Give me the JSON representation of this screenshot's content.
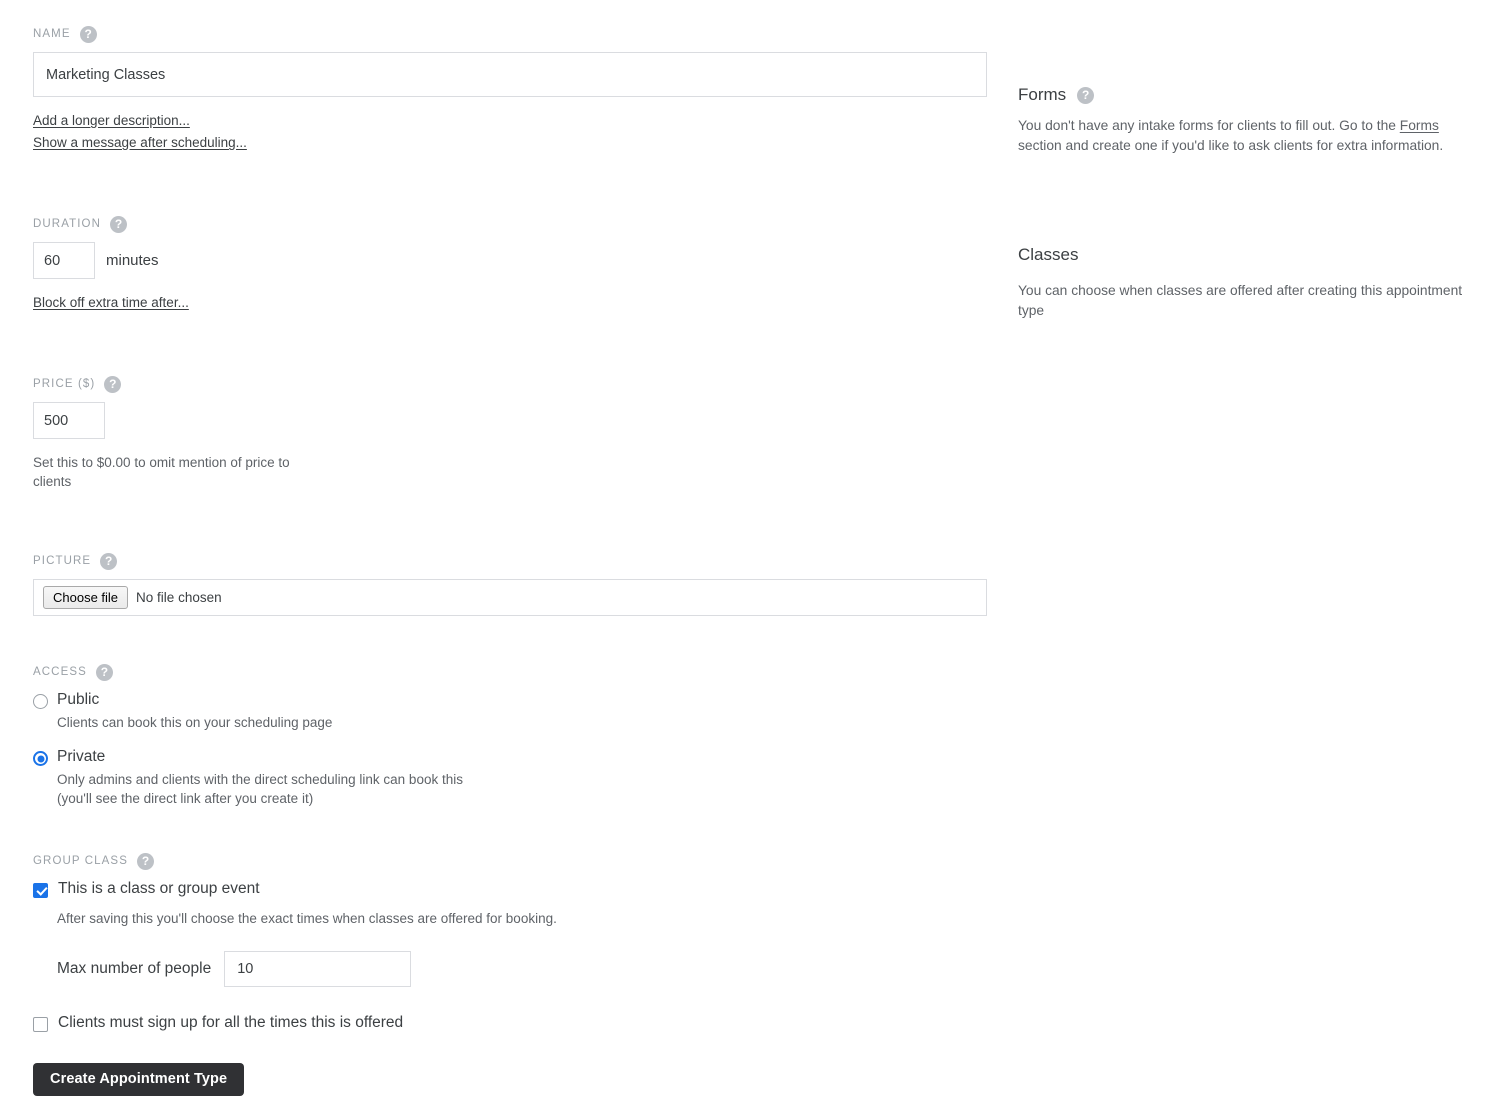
{
  "form": {
    "name": {
      "label": "NAME",
      "value": "Marketing Classes",
      "help_icon": "help-circle-icon",
      "links": [
        "Add a longer description...",
        "Show a message after scheduling..."
      ]
    },
    "duration": {
      "label": "DURATION",
      "value": "60",
      "unit": "minutes",
      "link": "Block off extra time after..."
    },
    "price": {
      "label": "PRICE ($)",
      "value": "500",
      "hint": "Set this to $0.00 to omit mention of price to clients"
    },
    "picture": {
      "label": "PICTURE",
      "button_label": "Choose file",
      "status": "No file chosen"
    },
    "access": {
      "label": "ACCESS",
      "options": [
        {
          "title": "Public",
          "description": "Clients can book this on your scheduling page",
          "selected": false
        },
        {
          "title": "Private",
          "description_line1": "Only admins and clients with the direct scheduling link can book this",
          "description_line2": "(you'll see the direct link after you create it)",
          "selected": true
        }
      ]
    },
    "group_class": {
      "label": "GROUP CLASS",
      "is_class_checkbox": {
        "label": "This is a class or group event",
        "checked": true
      },
      "hint": "After saving this you'll choose the exact times when classes are offered for booking.",
      "max_people": {
        "label": "Max number of people",
        "value": "10"
      },
      "all_times_checkbox": {
        "label": "Clients must sign up for all the times this is offered",
        "checked": false
      }
    },
    "submit_label": "Create Appointment Type"
  },
  "sidebar": {
    "forms": {
      "title": "Forms",
      "help_icon": "help-circle-icon",
      "text_before_link": "You don't have any intake forms for clients to fill out. Go to the ",
      "link_label": "Forms",
      "text_after_link": " section and create one if you'd like to ask clients for extra information."
    },
    "classes": {
      "title": "Classes",
      "text": "You can choose when classes are offered after creating this appointment type"
    }
  },
  "colors": {
    "accent": "#1a73e8",
    "submit_bg": "#303134",
    "label_gray": "#9aa0a6",
    "body_gray": "#5f6368",
    "border": "#dadce0"
  },
  "icons": {
    "help": "?"
  }
}
